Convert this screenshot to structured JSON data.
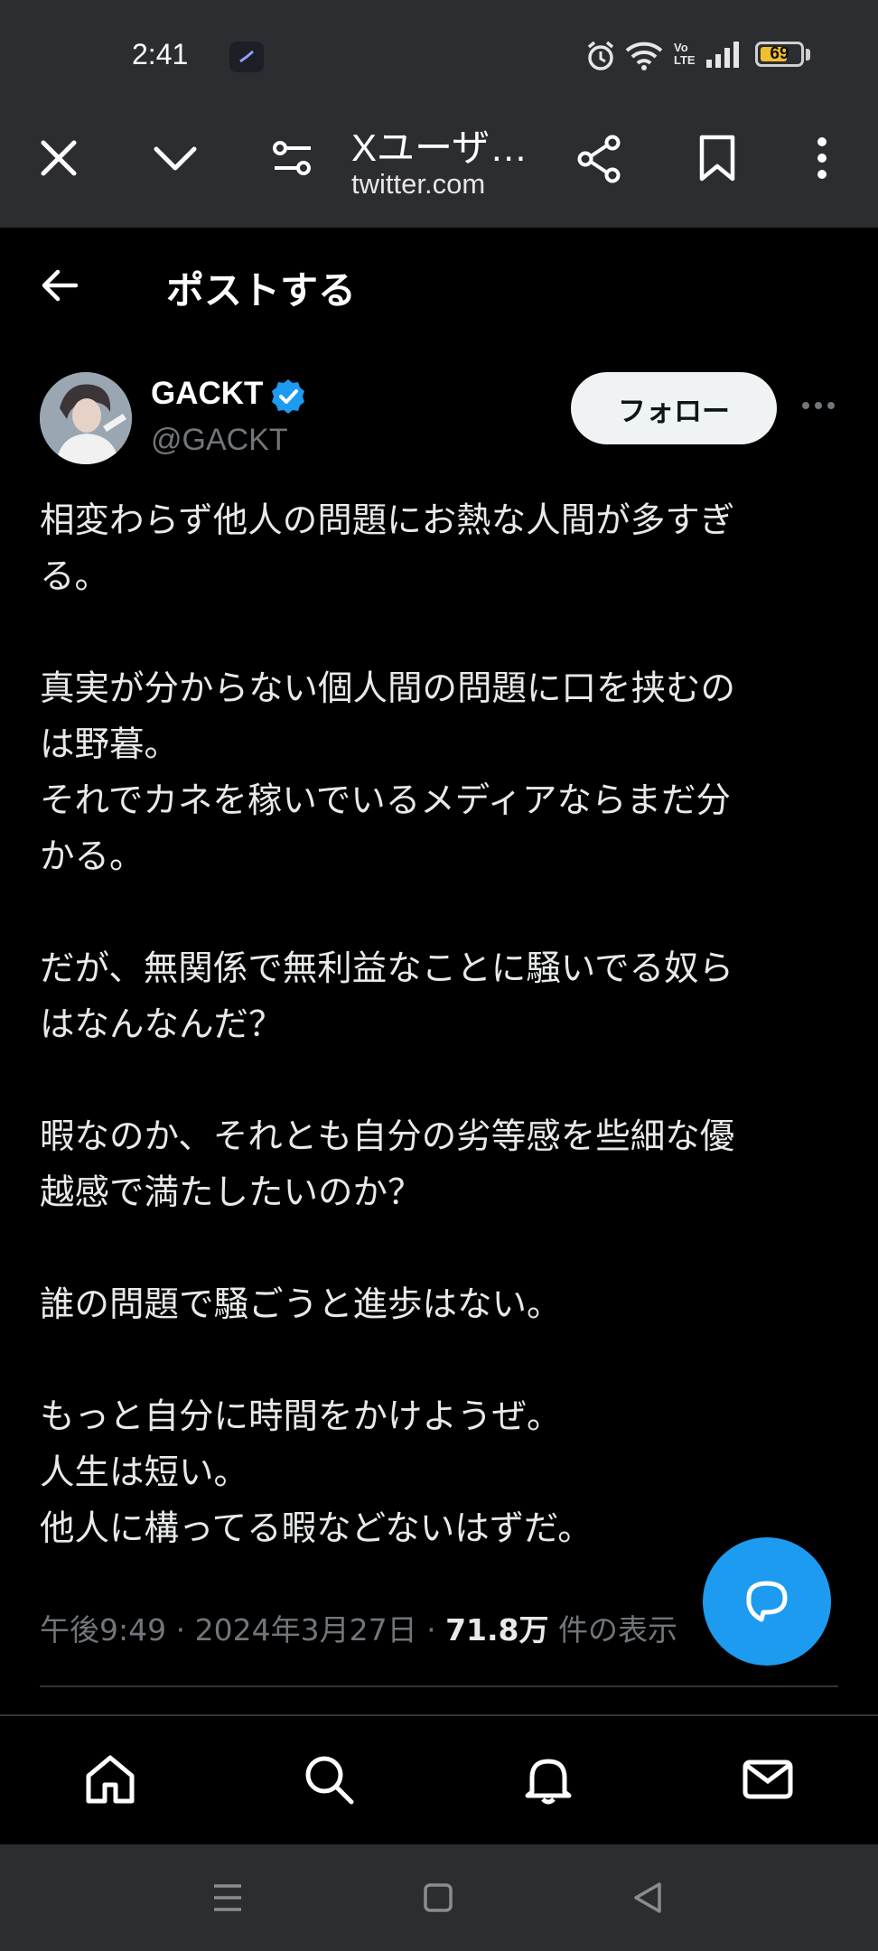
{
  "status_bar": {
    "time": "2:41",
    "battery_level": "69",
    "battery_fraction": 0.69,
    "network_label": "VoLTE",
    "icons": [
      "notification-app-icon",
      "alarm-icon",
      "wifi-icon",
      "volte-icon",
      "signal-icon",
      "battery-icon"
    ]
  },
  "browser": {
    "page_title": "Xユーザ…",
    "url": "twitter.com",
    "icons": [
      "close-icon",
      "chevron-down-icon",
      "site-settings-icon",
      "share-icon",
      "bookmark-icon",
      "more-vertical-icon"
    ]
  },
  "header": {
    "back_icon": "arrow-left-icon",
    "title": "ポストする"
  },
  "author": {
    "name": "GACKT",
    "handle": "@GACKT",
    "verified": true,
    "follow_label": "フォロー"
  },
  "tweet": {
    "paragraphs": [
      [
        "相変わらず他人の問題にお熱な人間が多すぎ",
        "る。"
      ],
      [
        "真実が分からない個人間の問題に口を挟むの",
        "は野暮。",
        "それでカネを稼いでいるメディアならまだ分",
        "かる。"
      ],
      [
        "だが、無関係で無利益なことに騒いでる奴ら",
        "はなんなんだ？"
      ],
      [
        "暇なのか、それとも自分の劣等感を些細な優",
        "越感で満たしたいのか？"
      ],
      [
        "誰の問題で騒ごうと進歩はない。"
      ],
      [
        "もっと自分に時間をかけようぜ。",
        "人生は短い。",
        "他人に構ってる暇などないはずだ。"
      ]
    ],
    "time": "午後9:49",
    "date": "2024年3月27日",
    "views_count": "71.8万",
    "views_label": "件の表示"
  },
  "tab_bar": {
    "tabs": [
      "home-icon",
      "search-icon",
      "notifications-icon",
      "messages-icon"
    ]
  },
  "colors": {
    "accent": "#1d9bf0",
    "background": "#000000",
    "chrome": "#2c2d31",
    "muted_text": "#71767b"
  }
}
